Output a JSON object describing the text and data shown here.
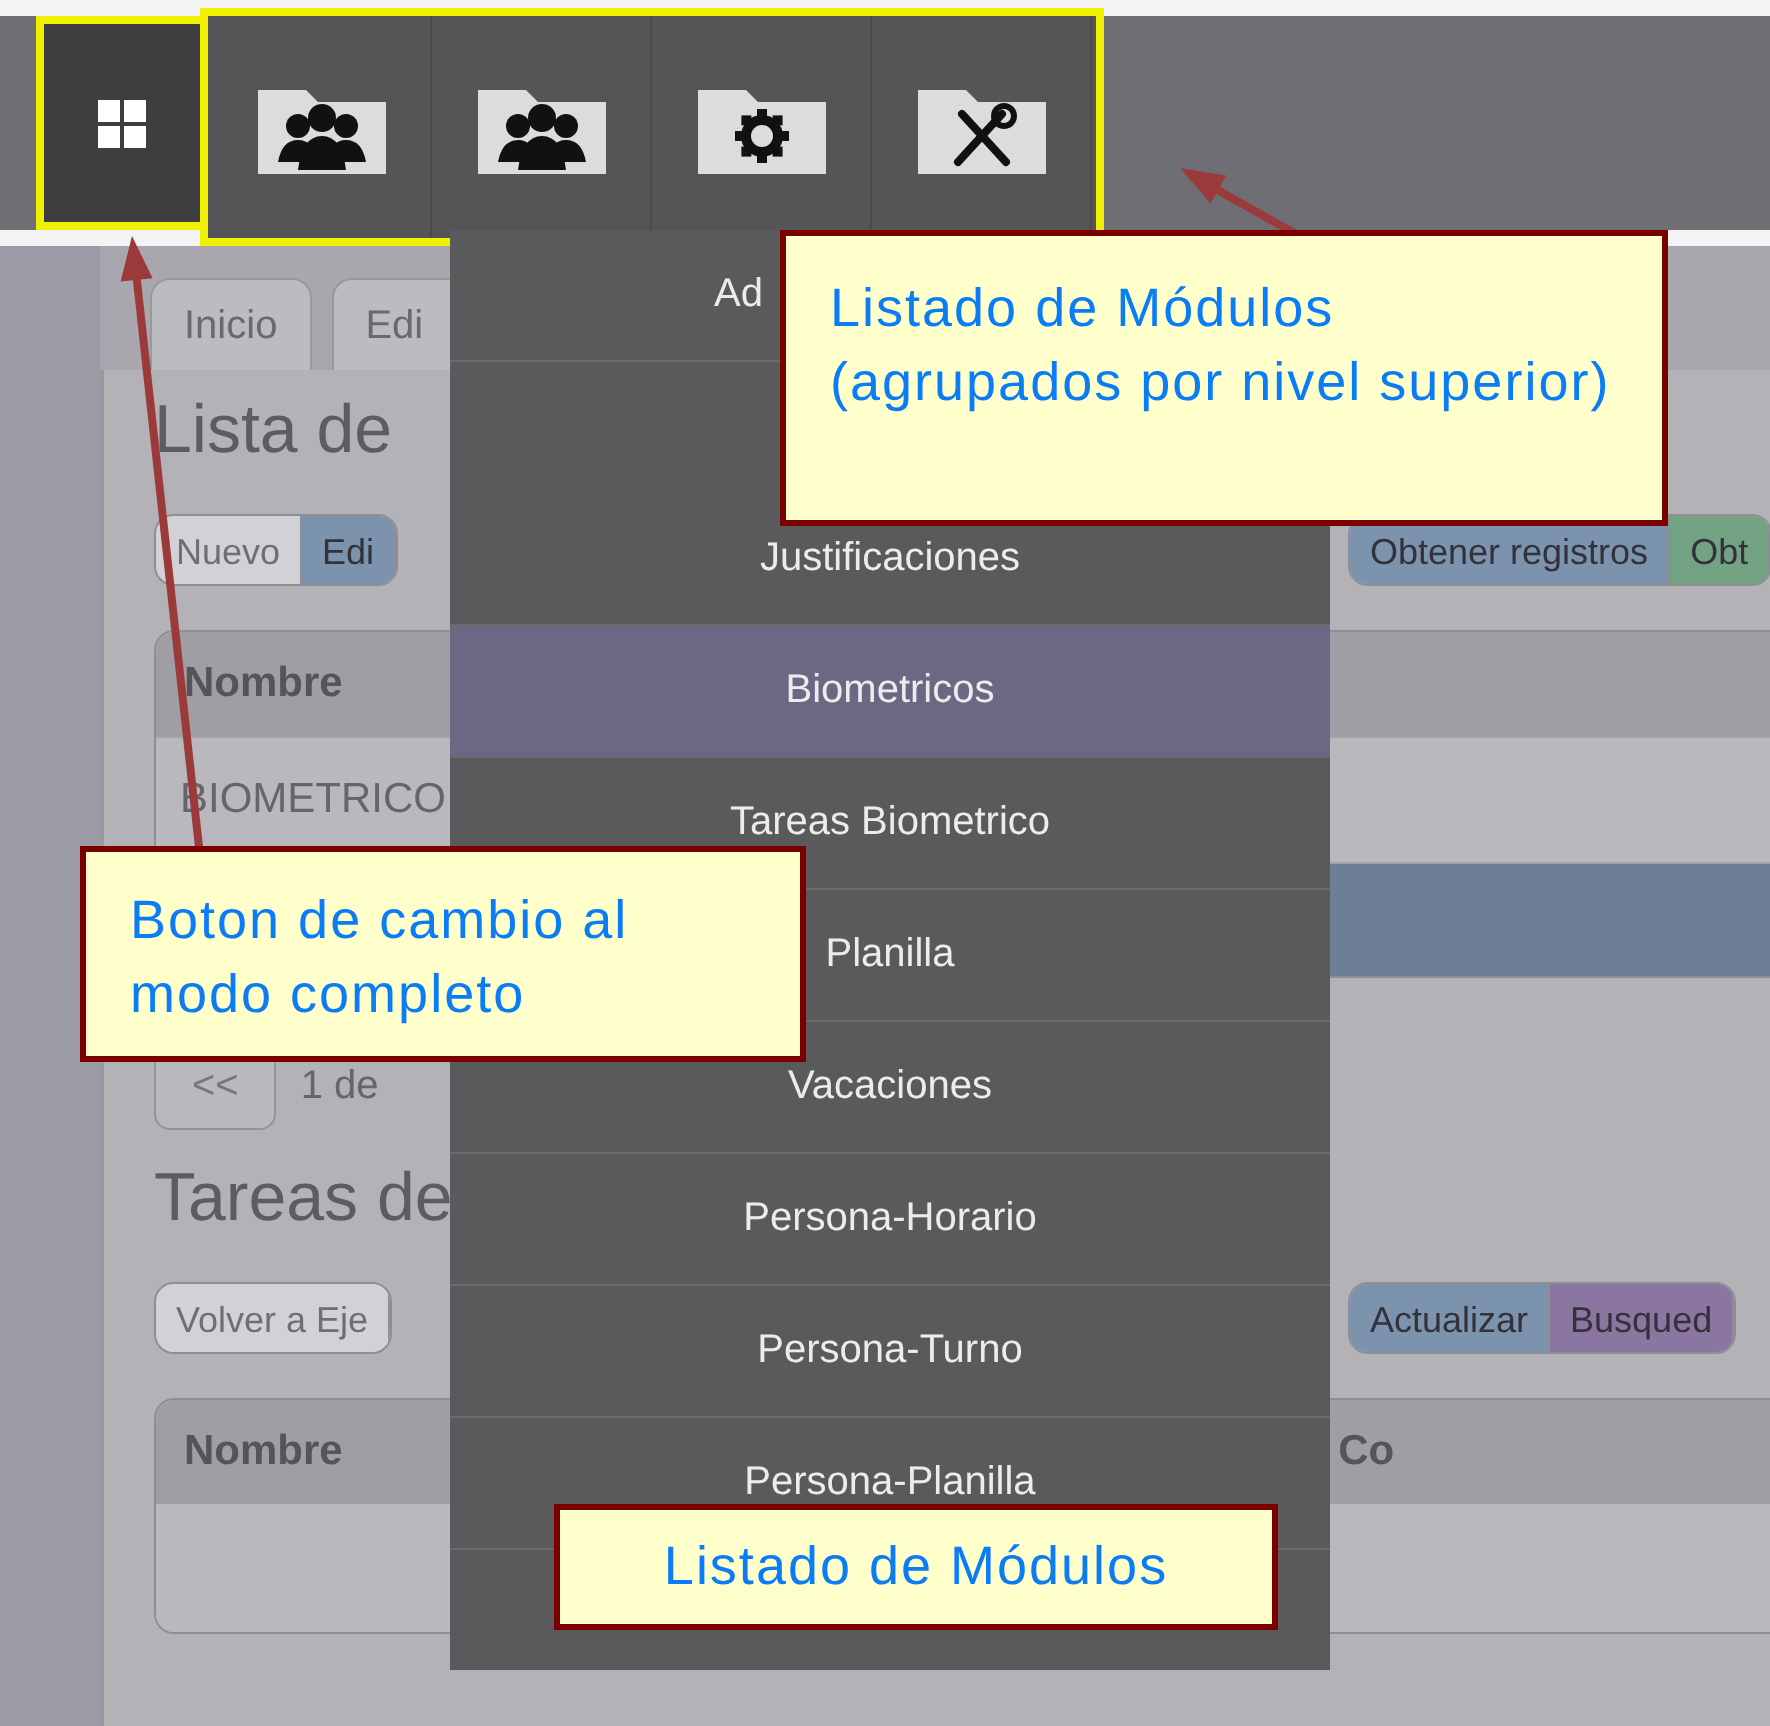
{
  "top_bar": {
    "mode_button": {
      "highlighted": true
    },
    "modules": [
      {
        "kind": "people"
      },
      {
        "kind": "people"
      },
      {
        "kind": "gear"
      },
      {
        "kind": "tools"
      }
    ],
    "modules_highlighted": true
  },
  "tabs": [
    {
      "label": "Inicio"
    },
    {
      "label": "Edi"
    }
  ],
  "sections": [
    {
      "title": "Lista de",
      "button_groups": [
        {
          "buttons": [
            {
              "label": "Nuevo",
              "color": "#d2d1d6"
            },
            {
              "label": "Edi",
              "color": "#7b93ad"
            }
          ]
        },
        {
          "buttons": [
            {
              "label": "Obtener registros",
              "color": "#7b93ad"
            },
            {
              "label": "Obt",
              "color": "#73a383"
            }
          ]
        }
      ],
      "table": {
        "columns": [
          "Nombre"
        ],
        "rows": [
          {
            "cells": [
              "BIOMETRICO"
            ],
            "selected": false
          },
          {
            "selected": true
          }
        ]
      },
      "pager": [
        "<<",
        "1 de"
      ]
    },
    {
      "title": "Tareas de",
      "button_groups": [
        {
          "buttons": [
            {
              "label": "Volver a Eje",
              "color": "#d2d1d6"
            }
          ]
        },
        {
          "buttons": [
            {
              "label": "Actualizar",
              "color": "#7b93ad"
            },
            {
              "label": "Busqued",
              "color": "#8a76a0"
            }
          ]
        }
      ],
      "table": {
        "columns": [
          "Nombre",
          "Co"
        ]
      }
    }
  ],
  "menu": {
    "items": [
      {
        "label": "Ad",
        "selected": false
      },
      {
        "label": "Justificaciones",
        "selected": false
      },
      {
        "label": "Biometricos",
        "selected": true
      },
      {
        "label": "Tareas Biometrico",
        "selected": false
      },
      {
        "label": "Planilla",
        "selected": false
      },
      {
        "label": "Vacaciones",
        "selected": false
      },
      {
        "label": "Persona-Horario",
        "selected": false
      },
      {
        "label": "Persona-Turno",
        "selected": false
      },
      {
        "label": "Persona-Planilla",
        "selected": false
      }
    ]
  },
  "annotations": [
    {
      "text": "Listado de Módulos (agrupados por nivel superior)"
    },
    {
      "text": "Boton de cambio al modo completo"
    },
    {
      "text": "Listado de Módulos"
    }
  ]
}
